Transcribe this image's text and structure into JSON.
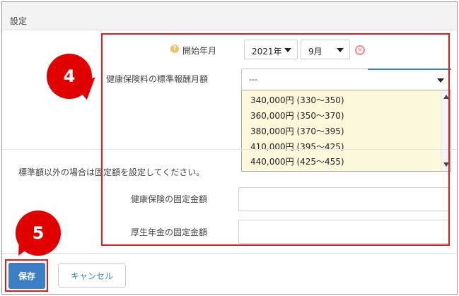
{
  "panel": {
    "title": "設定"
  },
  "form": {
    "start_label": "開始年月",
    "help_icon_glyph": "?",
    "year_value": "2021年",
    "month_value": "9月",
    "clear_icon_glyph": "×",
    "health_grade_label": "健康保険料の標準報酬月額",
    "health_grade_value": "---",
    "fixed_note": "標準額以外の場合は固定額を設定してください。",
    "health_fixed_label": "健康保険の固定金額",
    "pension_fixed_label": "厚生年金の固定金額",
    "health_fixed_value": "",
    "pension_fixed_value": ""
  },
  "dropdown": {
    "options": [
      "340,000円 (330～350)",
      "360,000円 (350～370)",
      "380,000円 (370～395)",
      "410,000円 (395～425)",
      "440,000円 (425～455)"
    ]
  },
  "annotations": {
    "step4": "4",
    "step5": "5",
    "color": "#e00000"
  },
  "buttons": {
    "save": "保存",
    "cancel": "キャンセル"
  },
  "colors": {
    "primary": "#3c7fc4",
    "dropdown_bg": "#fbf8dc",
    "highlight": "#e01b1b"
  }
}
